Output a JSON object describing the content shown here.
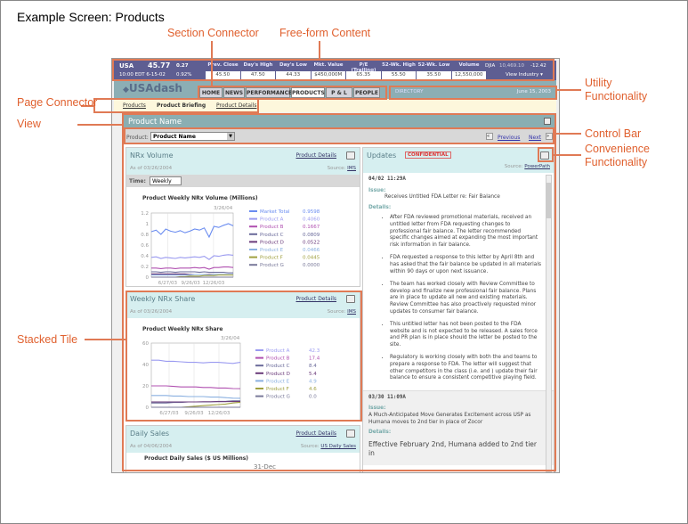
{
  "page_title": "Example Screen: Products",
  "annotations": {
    "section_connector": "Section Connector",
    "freeform": "Free-form Content",
    "page_connector": "Page Connector",
    "view": "View",
    "utility": "Utility",
    "utility2": "Functionality",
    "control_bar": "Control Bar",
    "convenience": "Convenience",
    "convenience2": "Functionality",
    "stacked_tile": "Stacked Tile"
  },
  "accent_color": "#e07a55",
  "ticker": {
    "symbol": "USA",
    "price": "45.77",
    "change": "0.27",
    "time": "10:00 EDT 6-15-02",
    "pct": "0.92%",
    "columns": [
      {
        "h": "Prev. Close",
        "v": "45.50"
      },
      {
        "h": "Day's High",
        "v": "47.50"
      },
      {
        "h": "Day's Low",
        "v": "44.33"
      },
      {
        "h": "Mkt. Value",
        "v": "$450,000M"
      },
      {
        "h": "P/E (Trailing)",
        "v": "65.35"
      },
      {
        "h": "52-Wk. High",
        "v": "55.50"
      },
      {
        "h": "52-Wk. Low",
        "v": "35.50"
      },
      {
        "h": "Volume",
        "v": "12,550,000"
      }
    ],
    "djia_label": "DJIA",
    "djia": "10,469.10",
    "djia_change": "-12.42",
    "view_industry": "View Industry ▾"
  },
  "logo": "USAdash",
  "tabs": [
    "HOME",
    "NEWS",
    "PERFORMANCE",
    "PRODUCTS",
    "P & L",
    "PEOPLE"
  ],
  "directory": "DIRECTORY",
  "date": "June 15, 2003",
  "breadcrumbs": [
    "Products",
    "Product Briefing",
    "Product Details"
  ],
  "view": {
    "title": "Product Name",
    "product_label": "Product:",
    "product_select": "Product Name",
    "previous": "Previous",
    "next": "Next"
  },
  "tiles": [
    {
      "title": "NRx Volume",
      "asof": "As of 03/26/2004",
      "link": "Product Details",
      "source_label": "Source:",
      "source": "IMS",
      "time_label": "Time:",
      "time_value": "Weekly"
    },
    {
      "title": "Weekly NRx Share",
      "asof": "As of 03/26/2004",
      "link": "Product Details",
      "source_label": "Source:",
      "source": "IMS"
    },
    {
      "title": "Daily Sales",
      "asof": "As of 04/06/2004",
      "link": "Product Details",
      "source_label": "Source:",
      "source": "US Daily Sales"
    }
  ],
  "chart_data": [
    {
      "type": "line",
      "title": "Product Weekly NRx Volume (Millions)",
      "date_label": "3/26/04",
      "ylim": [
        0,
        1.2
      ],
      "yticks": [
        "1.2",
        "1",
        "0.8",
        "0.6",
        "0.4",
        "0.2",
        "0"
      ],
      "xticks": [
        "6/27/03",
        "9/26/03",
        "12/26/03"
      ],
      "series": [
        {
          "name": "Market Total",
          "value": "0.9598",
          "color": "#6a8cf0",
          "values": [
            0.85,
            0.88,
            0.8,
            0.9,
            0.86,
            0.84,
            0.87,
            0.83,
            0.86,
            0.9,
            0.88,
            0.92,
            0.75,
            0.95,
            0.93,
            0.97,
            1.0,
            0.96
          ]
        },
        {
          "name": "Product A",
          "value": "0.4060",
          "color": "#9a9af0",
          "values": [
            0.37,
            0.38,
            0.35,
            0.37,
            0.36,
            0.35,
            0.37,
            0.36,
            0.37,
            0.38,
            0.37,
            0.39,
            0.33,
            0.4,
            0.39,
            0.41,
            0.42,
            0.41
          ]
        },
        {
          "name": "Product B",
          "value": "0.1667",
          "color": "#b050b0",
          "values": [
            0.17,
            0.17,
            0.16,
            0.17,
            0.17,
            0.16,
            0.17,
            0.17,
            0.17,
            0.18,
            0.17,
            0.18,
            0.15,
            0.18,
            0.18,
            0.19,
            0.19,
            0.18
          ]
        },
        {
          "name": "Product C",
          "value": "0.0809",
          "color": "#6a6a9a",
          "values": [
            0.1,
            0.1,
            0.09,
            0.1,
            0.1,
            0.09,
            0.1,
            0.1,
            0.1,
            0.1,
            0.09,
            0.1,
            0.09,
            0.09,
            0.09,
            0.09,
            0.08,
            0.08
          ]
        },
        {
          "name": "Product D",
          "value": "0.0522",
          "color": "#6a3a7a",
          "values": [
            0.06,
            0.06,
            0.06,
            0.06,
            0.06,
            0.06,
            0.06,
            0.06,
            0.05,
            0.05,
            0.05,
            0.05,
            0.05,
            0.05,
            0.05,
            0.05,
            0.05,
            0.05
          ]
        },
        {
          "name": "Product E",
          "value": "0.0466",
          "color": "#8ab0e0",
          "values": [
            0.04,
            0.04,
            0.04,
            0.04,
            0.04,
            0.04,
            0.04,
            0.04,
            0.04,
            0.05,
            0.05,
            0.05,
            0.04,
            0.05,
            0.05,
            0.05,
            0.05,
            0.05
          ]
        },
        {
          "name": "Product F",
          "value": "0.0445",
          "color": "#a0a040",
          "values": [
            0,
            0,
            0,
            0,
            0,
            0,
            0.01,
            0.01,
            0.02,
            0.02,
            0.02,
            0.03,
            0.03,
            0.03,
            0.04,
            0.04,
            0.04,
            0.04
          ]
        },
        {
          "name": "Product G",
          "value": "0.0000",
          "color": "#7a7a9a",
          "values": [
            0,
            0,
            0,
            0,
            0,
            0,
            0,
            0,
            0,
            0,
            0,
            0,
            0,
            0,
            0,
            0,
            0,
            0
          ]
        }
      ]
    },
    {
      "type": "line",
      "title": "Product Weekly NRx Share",
      "date_label": "3/26/04",
      "ylim": [
        0,
        60
      ],
      "yticks": [
        "60",
        "40",
        "20",
        "0"
      ],
      "xticks": [
        "6/27/03",
        "9/26/03",
        "12/26/03"
      ],
      "series": [
        {
          "name": "Product A",
          "value": "42.3",
          "color": "#9a9af0",
          "values": [
            44,
            44,
            43,
            43,
            42.5,
            42,
            42,
            41.5,
            42,
            42,
            41.5,
            41,
            42
          ]
        },
        {
          "name": "Product B",
          "value": "17.4",
          "color": "#b050b0",
          "values": [
            20,
            20,
            20,
            19.5,
            19,
            19,
            19,
            18.5,
            18.5,
            18,
            18,
            17.5,
            17.4
          ]
        },
        {
          "name": "Product C",
          "value": "8.4",
          "color": "#6a6a9a",
          "values": [
            4,
            4,
            4,
            4.5,
            4.5,
            5,
            5,
            5,
            5,
            5.5,
            5.5,
            6,
            6
          ]
        },
        {
          "name": "Product D",
          "value": "5.4",
          "color": "#6a3a7a",
          "values": [
            5,
            5,
            5,
            5,
            5,
            5,
            5,
            5.2,
            5.2,
            5.3,
            5.3,
            5.4,
            5.4
          ]
        },
        {
          "name": "Product E",
          "value": "4.9",
          "color": "#8ab0e0",
          "values": [
            11,
            11,
            11,
            10.5,
            10.5,
            10,
            10,
            10,
            9.5,
            9.5,
            9,
            8.5,
            8.4
          ]
        },
        {
          "name": "Product F",
          "value": "4.6",
          "color": "#a0a040",
          "values": [
            0,
            0,
            0,
            0,
            0,
            0.5,
            1,
            1.5,
            2,
            2.5,
            3,
            4,
            4.6
          ]
        },
        {
          "name": "Product G",
          "value": "0.0",
          "color": "#7a7a9a",
          "values": [
            0,
            0,
            0,
            0,
            0,
            0,
            0,
            0,
            0,
            0,
            0,
            0,
            0
          ]
        }
      ]
    },
    {
      "type": "line",
      "title": "Product Daily Sales ($ US Millions)",
      "date_label": "31-Dec"
    }
  ],
  "updates": {
    "title": "Updates",
    "badge": "CONFIDENTIAL",
    "source_label": "Source:",
    "source": "PowerPath",
    "entries": [
      {
        "stamp": "04/02 11:29A",
        "issue_label": "Issue:",
        "issue": "Receives Untitled FDA Letter re: Fair Balance",
        "details_label": "Details:",
        "bullets": [
          "After FDA reviewed promotional materials, received an untitled letter from FDA requesting changes to professional fair balance.  The letter recommended specific changes aimed at expanding the most important risk information in fair balance.",
          "FDA requested a response to this letter by April 8th and has asked that the fair balance be updated in all materials within 90 days or upon next issuance.",
          "The team has worked closely with Review Committee to develop and finalize new professional fair balance.  Plans are in place to update all new and existing materials.  Review Committee has also proactively requested minor updates to consumer fair balance.",
          "This untitled letter has not been posted to the FDA website and is not expected to be released.  A sales force and PR plan is in place should the letter be posted to the site.",
          "Regulatory is working closely with both the and teams to prepare a response to FDA.  The letter will suggest that other competitors in the class (i.e. and ) update their fair balance to ensure a consistent competitive playing field."
        ]
      },
      {
        "stamp": "03/30 11:09A",
        "issue_label": "Issue:",
        "issue": "A Much-Anticipated Move Generates Excitement across USP as Humana moves to 2nd tier in place of Zocor",
        "details_label": "Details:",
        "detail_text": "Effective February 2nd, Humana added to 2nd tier in"
      }
    ]
  }
}
